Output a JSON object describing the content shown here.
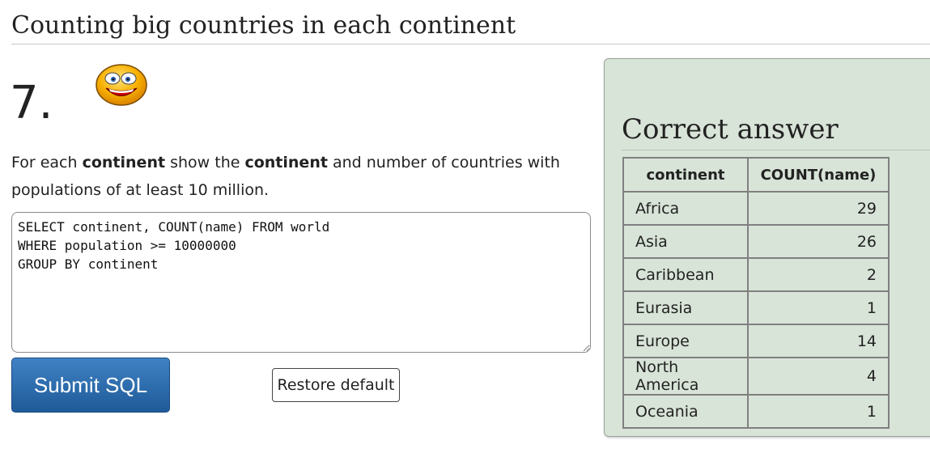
{
  "page": {
    "title": "Counting big countries in each continent"
  },
  "question": {
    "number": "7.",
    "icon": "smiley-icon",
    "text_parts": [
      "For each ",
      "continent",
      " show the ",
      "continent",
      " and number of countries with populations of at least 10 million."
    ]
  },
  "editor": {
    "sql": "SELECT continent, COUNT(name) FROM world\nWHERE population >= 10000000\nGROUP BY continent"
  },
  "buttons": {
    "submit_label": "Submit SQL",
    "restore_label": "Restore default"
  },
  "answer": {
    "title": "Correct answer",
    "headers": [
      "continent",
      "COUNT(name)"
    ],
    "rows": [
      [
        "Africa",
        "29"
      ],
      [
        "Asia",
        "26"
      ],
      [
        "Caribbean",
        "2"
      ],
      [
        "Eurasia",
        "1"
      ],
      [
        "Europe",
        "14"
      ],
      [
        "North America",
        "4"
      ],
      [
        "Oceania",
        "1"
      ]
    ]
  },
  "colors": {
    "panel_bg": "#d8e4d8",
    "submit_bg": "#2a6aad",
    "smiley_face": "#f7a800"
  }
}
